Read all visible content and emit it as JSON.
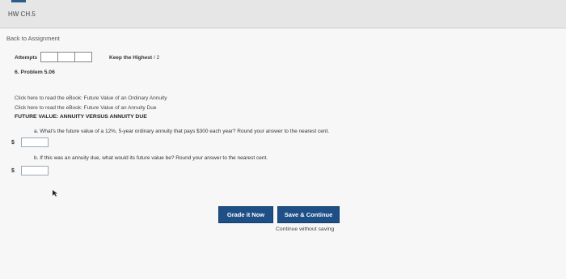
{
  "header": {
    "title": "HW CH.5"
  },
  "nav": {
    "back_label": "Back to Assignment"
  },
  "attempts": {
    "label": "Attempts",
    "box_count": 3,
    "keep_prefix": "Keep the Highest",
    "keep_value": "/ 2"
  },
  "problem": {
    "label": "6. Problem 5.06"
  },
  "ebook": {
    "link1": "Click here to read the eBook: Future Value of an Ordinary Annuity",
    "link2": "Click here to read the eBook: Future Value of an Annuity Due"
  },
  "section": {
    "heading": "FUTURE VALUE: ANNUITY VERSUS ANNUITY DUE"
  },
  "questions": {
    "a_text": "a. What's the future value of a 12%, 5-year ordinary annuity that pays $300 each year? Round your answer to the nearest cent.",
    "a_currency": "$",
    "a_value": "",
    "b_text": "b. If this was an annuity due, what would its future value be? Round your answer to the nearest cent.",
    "b_currency": "$",
    "b_value": ""
  },
  "actions": {
    "grade_label": "Grade it Now",
    "save_label": "Save & Continue",
    "continue_label": "Continue without saving"
  },
  "colors": {
    "button_bg": "#1e4f86",
    "accent": "#2b5c8a"
  },
  "icons": {
    "cursor": "mouse-pointer-icon"
  }
}
